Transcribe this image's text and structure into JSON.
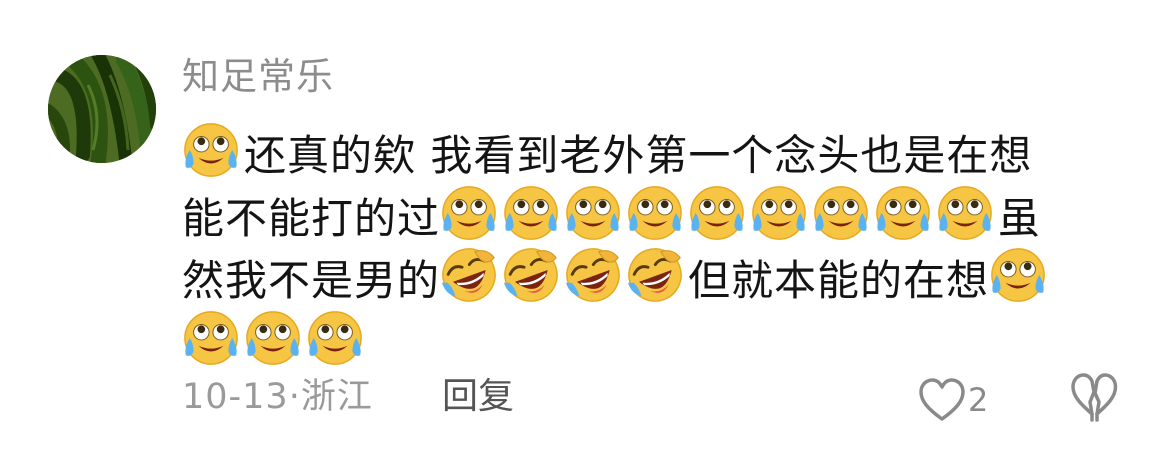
{
  "comment": {
    "author": "知足常乐",
    "segments": [
      [
        {
          "type": "emoji",
          "name": "tears-of-joy"
        },
        {
          "type": "text",
          "text": "还真的欸  我看到老外第一个念头也是在想"
        }
      ],
      [
        {
          "type": "text",
          "text": "能不能打的过"
        },
        {
          "type": "emoji",
          "name": "tears-of-joy"
        },
        {
          "type": "emoji",
          "name": "tears-of-joy"
        },
        {
          "type": "emoji",
          "name": "tears-of-joy"
        },
        {
          "type": "emoji",
          "name": "tears-of-joy"
        },
        {
          "type": "emoji",
          "name": "tears-of-joy"
        },
        {
          "type": "emoji",
          "name": "tears-of-joy"
        },
        {
          "type": "emoji",
          "name": "tears-of-joy"
        },
        {
          "type": "emoji",
          "name": "tears-of-joy"
        },
        {
          "type": "emoji",
          "name": "tears-of-joy"
        },
        {
          "type": "text",
          "text": "虽"
        }
      ],
      [
        {
          "type": "text",
          "text": "然我不是男的"
        },
        {
          "type": "emoji",
          "name": "rolling-laughing"
        },
        {
          "type": "emoji",
          "name": "rolling-laughing"
        },
        {
          "type": "emoji",
          "name": "rolling-laughing"
        },
        {
          "type": "emoji",
          "name": "rolling-laughing"
        },
        {
          "type": "text",
          "text": "但就本能的在想"
        },
        {
          "type": "emoji",
          "name": "tears-of-joy"
        }
      ],
      [
        {
          "type": "emoji",
          "name": "tears-of-joy"
        },
        {
          "type": "emoji",
          "name": "tears-of-joy"
        },
        {
          "type": "emoji",
          "name": "tears-of-joy"
        }
      ]
    ],
    "date": "10-13",
    "separator": "·",
    "location": "浙江",
    "reply_label": "回复",
    "like_count": "2",
    "like_icon": "heart-outline-icon",
    "dislike_icon": "broken-heart-outline-icon",
    "avatar_icon": "green-chili-peppers-photo"
  }
}
